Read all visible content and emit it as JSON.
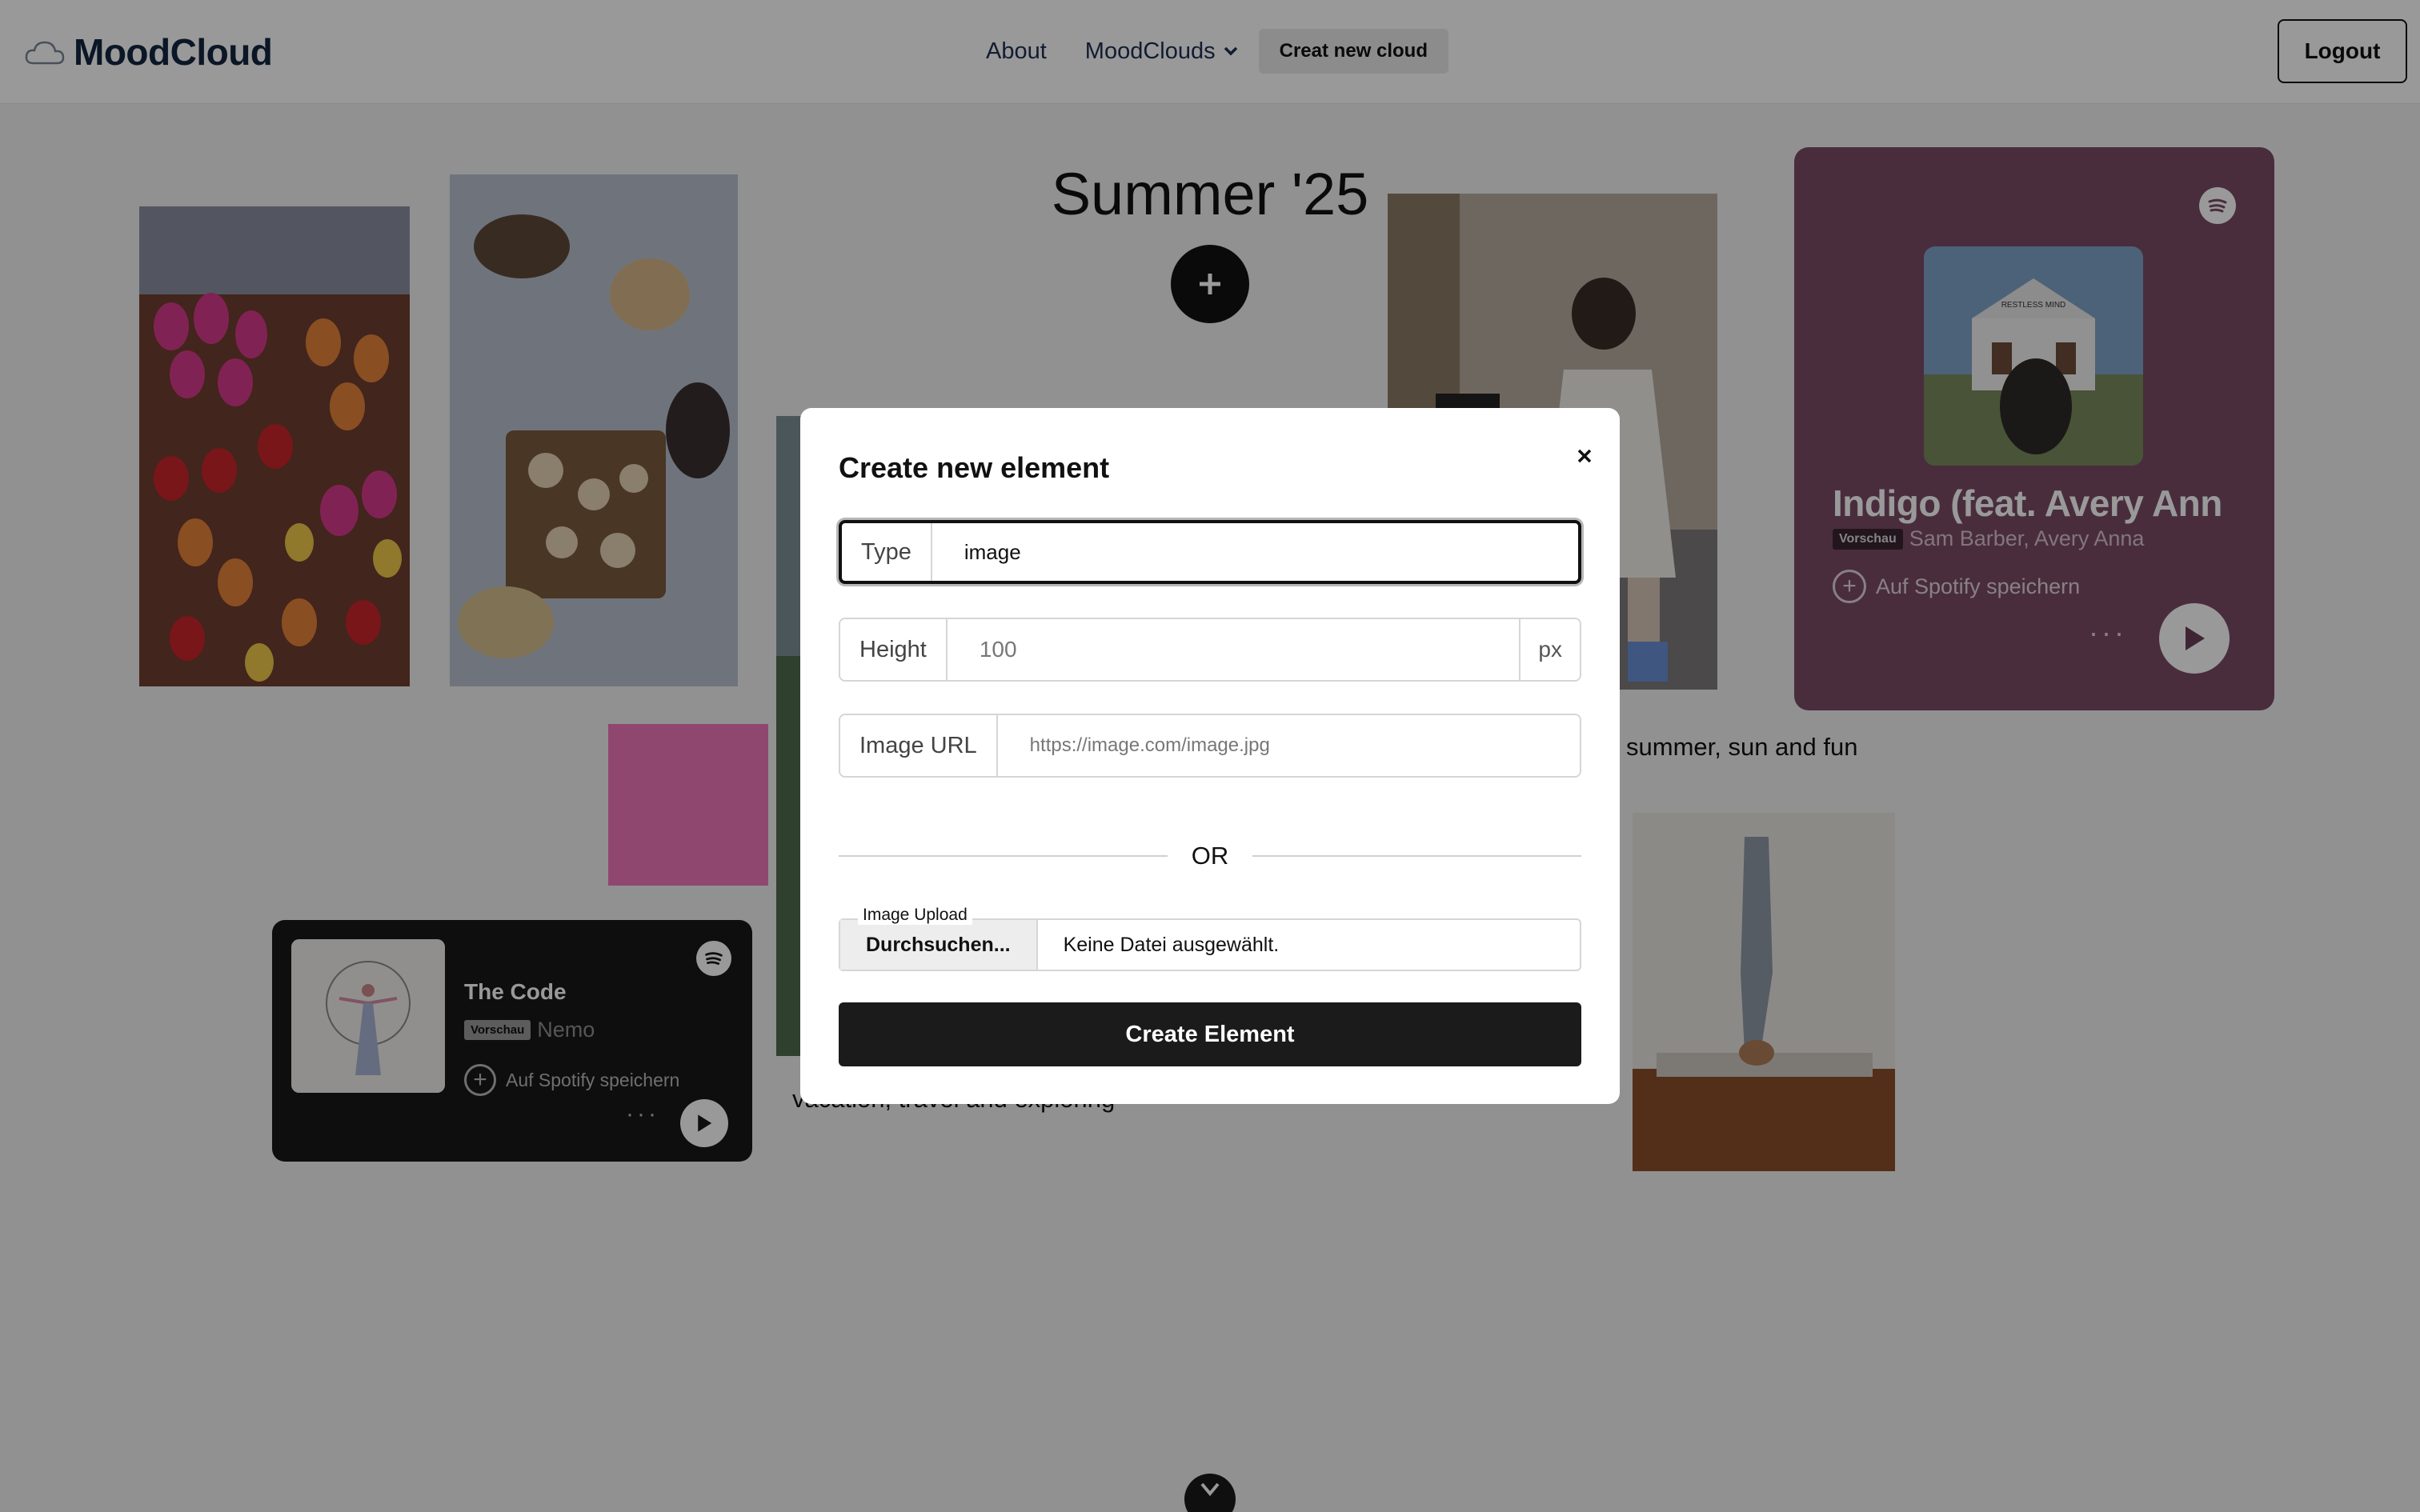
{
  "navbar": {
    "brand": "MoodCloud",
    "links": {
      "about": "About",
      "moodclouds": "MoodClouds"
    },
    "create_button": "Creat new cloud",
    "logout": "Logout"
  },
  "board": {
    "title": "Summer '25",
    "captions": {
      "summer": "summer, sun and fun",
      "vacation": "vacation, travel and exploring"
    },
    "colors": {
      "pink_block": "#f177b9"
    }
  },
  "spotify_large": {
    "track": "Indigo (feat. Avery Ann",
    "badge": "Vorschau",
    "artist": "Sam Barber, Avery Anna",
    "save": "Auf Spotify speichern",
    "album_text": "RESTLESS MIND"
  },
  "spotify_small": {
    "track": "The Code",
    "badge": "Vorschau",
    "artist": "Nemo",
    "save": "Auf Spotify speichern"
  },
  "modal": {
    "title": "Create new element",
    "type": {
      "label": "Type",
      "value": "image"
    },
    "height": {
      "label": "Height",
      "placeholder": "100",
      "suffix": "px"
    },
    "image_url": {
      "label": "Image URL",
      "placeholder": "https://image.com/image.jpg"
    },
    "divider": "OR",
    "upload": {
      "legend": "Image Upload",
      "browse": "Durchsuchen...",
      "filename": "Keine Datei ausgewählt."
    },
    "submit": "Create Element"
  }
}
